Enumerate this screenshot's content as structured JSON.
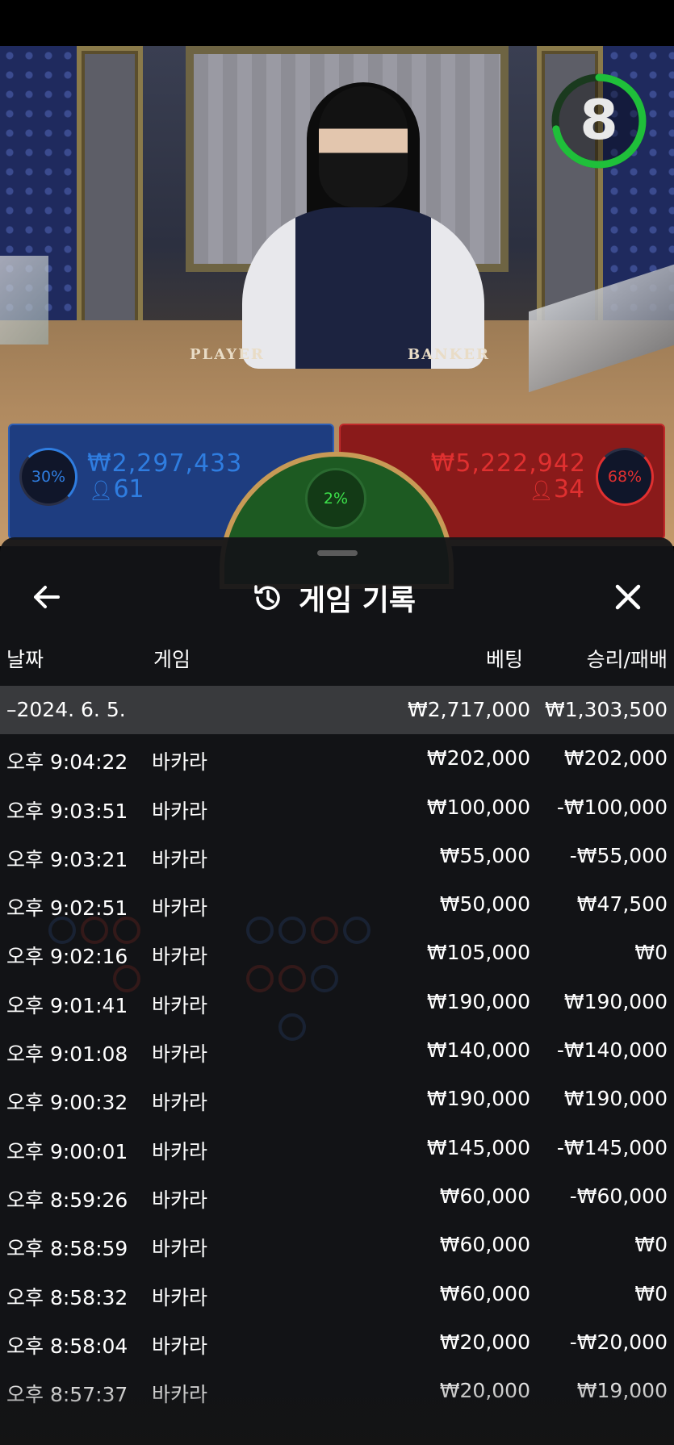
{
  "timer": {
    "value": "8",
    "fraction": 0.72,
    "color": "#1fbf3a"
  },
  "bets": {
    "player": {
      "percent": "30%",
      "amount": "₩2,297,433",
      "count": "61",
      "color": "#2f7de0"
    },
    "tie": {
      "percent": "2%",
      "color": "#3ce04a"
    },
    "banker": {
      "percent": "68%",
      "amount": "₩5,222,942",
      "count": "34",
      "color": "#e03030"
    }
  },
  "table_labels": {
    "player": "PLAYER",
    "banker": "BANKER"
  },
  "sheet": {
    "title": "게임 기록",
    "columns": {
      "date": "날짜",
      "game": "게임",
      "bet": "베팅",
      "result": "승리/패배"
    },
    "rows": [
      {
        "time": "–2024. 6. 5.",
        "game": "",
        "bet": "₩2,717,000",
        "result": "₩1,303,500",
        "day": true
      },
      {
        "time": "오후 9:04:22",
        "game": "바카라",
        "bet": "₩202,000",
        "result": "₩202,000"
      },
      {
        "time": "오후 9:03:51",
        "game": "바카라",
        "bet": "₩100,000",
        "result": "-₩100,000"
      },
      {
        "time": "오후 9:03:21",
        "game": "바카라",
        "bet": "₩55,000",
        "result": "-₩55,000"
      },
      {
        "time": "오후 9:02:51",
        "game": "바카라",
        "bet": "₩50,000",
        "result": "₩47,500"
      },
      {
        "time": "오후 9:02:16",
        "game": "바카라",
        "bet": "₩105,000",
        "result": "₩0"
      },
      {
        "time": "오후 9:01:41",
        "game": "바카라",
        "bet": "₩190,000",
        "result": "₩190,000"
      },
      {
        "time": "오후 9:01:08",
        "game": "바카라",
        "bet": "₩140,000",
        "result": "-₩140,000"
      },
      {
        "time": "오후 9:00:32",
        "game": "바카라",
        "bet": "₩190,000",
        "result": "₩190,000"
      },
      {
        "time": "오후 9:00:01",
        "game": "바카라",
        "bet": "₩145,000",
        "result": "-₩145,000"
      },
      {
        "time": "오후 8:59:26",
        "game": "바카라",
        "bet": "₩60,000",
        "result": "-₩60,000"
      },
      {
        "time": "오후 8:58:59",
        "game": "바카라",
        "bet": "₩60,000",
        "result": "₩0"
      },
      {
        "time": "오후 8:58:32",
        "game": "바카라",
        "bet": "₩60,000",
        "result": "₩0"
      },
      {
        "time": "오후 8:58:04",
        "game": "바카라",
        "bet": "₩20,000",
        "result": "-₩20,000"
      },
      {
        "time": "오후 8:57:37",
        "game": "바카라",
        "bet": "₩20,000",
        "result": "₩19,000"
      }
    ]
  }
}
